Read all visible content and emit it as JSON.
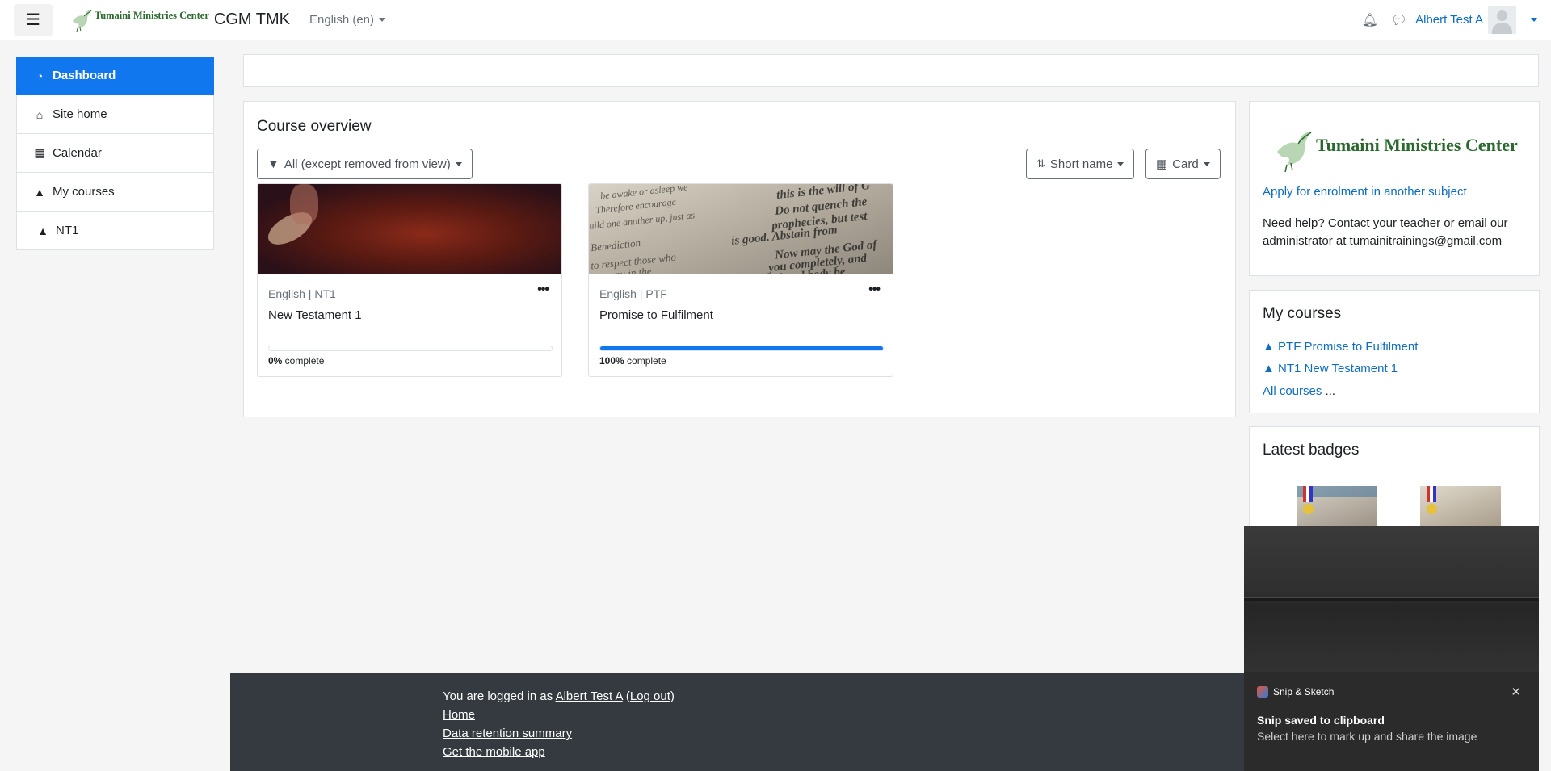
{
  "navbar": {
    "menu_icon": "hamburger-icon",
    "logo_text": "Tumaini Ministries Center",
    "site_name": "CGM TMK",
    "language": "English (en)",
    "bell_icon": "bell-icon",
    "chat_icon": "chat-icon",
    "user_name": "Albert Test A"
  },
  "sidebar": {
    "items": [
      {
        "label": "Dashboard",
        "icon": "dashboard-icon",
        "active": true
      },
      {
        "label": "Site home",
        "icon": "home-icon"
      },
      {
        "label": "Calendar",
        "icon": "calendar-icon"
      },
      {
        "label": "My courses",
        "icon": "graduation-cap-icon"
      },
      {
        "label": "NT1",
        "icon": "graduation-cap-icon"
      }
    ]
  },
  "overview": {
    "title": "Course overview",
    "filter_label": "All (except removed from view)",
    "sort_label": "Short name",
    "view_label": "Card",
    "courses": [
      {
        "category": "English | NT1",
        "name": "New Testament 1",
        "progress_pct": 0,
        "progress_value": "0%",
        "progress_suffix": " complete"
      },
      {
        "category": "English | PTF",
        "name": "Promise to Fulfilment",
        "progress_pct": 100,
        "progress_value": "100%",
        "progress_suffix": " complete"
      }
    ],
    "ptf_image_lines": [
      "be awake or asleep we",
      "Therefore encourage",
      "uild one another up, just as",
      "Benediction",
      "to respect those who",
      "over you in the",
      "this is the will of G",
      "Do not quench the",
      "prophecies, but test",
      "is good. Abstain from",
      "Now may the God of",
      "you completely, and",
      "soul and body be"
    ]
  },
  "right": {
    "logo_text": "Tumaini Ministries Center",
    "apply_link": "Apply for enrolment in another subject",
    "help_text": "Need help? Contact your teacher or email our administrator at tumainitrainings@gmail.com",
    "my_courses": {
      "title": "My courses",
      "items": [
        "PTF Promise to Fulfilment",
        "NT1 New Testament 1"
      ],
      "all_link": "All courses",
      "all_suffix": " ..."
    },
    "badges": {
      "title": "Latest badges"
    }
  },
  "snip": {
    "app_name": "Snip & Sketch",
    "title": "Snip saved to clipboard",
    "subtitle": "Select here to mark up and share the image"
  },
  "footer": {
    "logged_prefix": "You are logged in as ",
    "user_link": "Albert Test A",
    "logout_link": "Log out",
    "links": [
      "Home",
      "Data retention summary",
      "Get the mobile app"
    ]
  }
}
